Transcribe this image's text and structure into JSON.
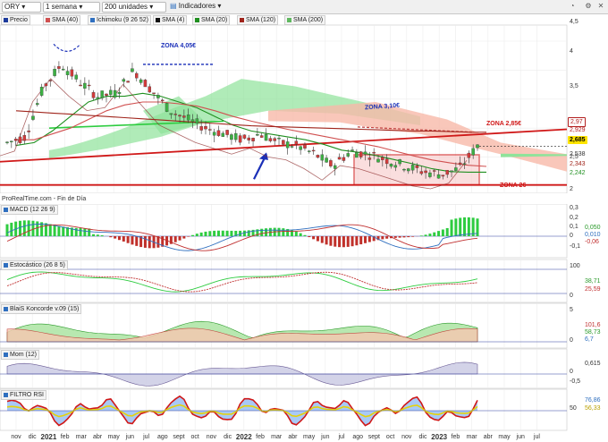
{
  "toolbar": {
    "symbol": "ORY",
    "timeframe": "1 semana",
    "units": "200 unidades",
    "indicators": "Indicadores"
  },
  "legend": [
    {
      "label": "Precio",
      "color": "#1c3a9c"
    },
    {
      "label": "SMA (40)",
      "color": "#d05050"
    },
    {
      "label": "Ichimoku (9 26 52)",
      "color": "#3070c0"
    },
    {
      "label": "SMA (4)",
      "color": "#111111"
    },
    {
      "label": "SMA (20)",
      "color": "#1f8f1f"
    },
    {
      "label": "SMA (120)",
      "color": "#a0241b"
    },
    {
      "label": "SMA (200)",
      "color": "#5fb85f"
    }
  ],
  "source_label": "ProRealTime.com - Fin de Día",
  "annotations": {
    "zona_405": "ZONA 4,05€",
    "zona_310": "ZONA 3,10€",
    "zona_285": "ZONA 2,85€",
    "zona_2": "ZONA 2€"
  },
  "price_axis": {
    "ticks": [
      "4,5",
      "4",
      "3,5",
      "3",
      "2,5",
      "2"
    ],
    "price_tags": [
      {
        "label": "2,97",
        "bg": "#ffffff",
        "fg": "#b32020"
      },
      {
        "label": "2,929",
        "bg": "#ffffff",
        "fg": "#b32020"
      },
      {
        "label": "2,685",
        "bg": "#ffe400",
        "fg": "#000000"
      },
      {
        "label": "2,538",
        "bg": "#ffffff",
        "fg": "#333333"
      },
      {
        "label": "2,343",
        "bg": "#ffffff",
        "fg": "#a0241b"
      },
      {
        "label": "2,242",
        "bg": "#ffffff",
        "fg": "#1f8f1f"
      }
    ]
  },
  "panels": {
    "macd": {
      "title": "MACD (12 26 9)",
      "ticks": [
        "0,3",
        "0,2",
        "0,1",
        "0",
        "-0,1"
      ],
      "tags": [
        {
          "label": "0,050",
          "fg": "#2a9a2a"
        },
        {
          "label": "0,010",
          "fg": "#2f6fbf"
        },
        {
          "label": "-0,06",
          "fg": "#c03030"
        }
      ]
    },
    "stoch": {
      "title": "Estocástico (26 8 5)",
      "ticks": [
        "100",
        "0"
      ],
      "tags": [
        {
          "label": "38,71",
          "fg": "#2a9a2a"
        },
        {
          "label": "25,59",
          "fg": "#c03030"
        }
      ]
    },
    "konc": {
      "title": "BlaiS Koncorde v.09 (15)",
      "ticks": [
        "5",
        "0"
      ],
      "tags": [
        {
          "label": "101,6",
          "fg": "#c03030"
        },
        {
          "label": "58,73",
          "fg": "#2a9a2a"
        },
        {
          "label": "6,7",
          "fg": "#2f6fbf"
        }
      ]
    },
    "mom": {
      "title": "Mom (12)",
      "ticks": [
        "0",
        "-0,5"
      ],
      "tags": [
        {
          "label": "0,615",
          "fg": "#333333"
        }
      ]
    },
    "rsi": {
      "title": "FILTRO RSI",
      "ticks": [
        "50"
      ],
      "tags": [
        {
          "label": "76,86",
          "fg": "#2f6fbf"
        },
        {
          "label": "56,33",
          "fg": "#b8a000"
        }
      ]
    }
  },
  "x_axis": [
    {
      "label": "nov",
      "bold": false
    },
    {
      "label": "dic",
      "bold": false
    },
    {
      "label": "2021",
      "bold": true
    },
    {
      "label": "feb",
      "bold": false
    },
    {
      "label": "mar",
      "bold": false
    },
    {
      "label": "abr",
      "bold": false
    },
    {
      "label": "may",
      "bold": false
    },
    {
      "label": "jun",
      "bold": false
    },
    {
      "label": "jul",
      "bold": false
    },
    {
      "label": "ago",
      "bold": false
    },
    {
      "label": "sept",
      "bold": false
    },
    {
      "label": "oct",
      "bold": false
    },
    {
      "label": "nov",
      "bold": false
    },
    {
      "label": "dic",
      "bold": false
    },
    {
      "label": "2022",
      "bold": true
    },
    {
      "label": "feb",
      "bold": false
    },
    {
      "label": "mar",
      "bold": false
    },
    {
      "label": "abr",
      "bold": false
    },
    {
      "label": "may",
      "bold": false
    },
    {
      "label": "jun",
      "bold": false
    },
    {
      "label": "jul",
      "bold": false
    },
    {
      "label": "ago",
      "bold": false
    },
    {
      "label": "sept",
      "bold": false
    },
    {
      "label": "oct",
      "bold": false
    },
    {
      "label": "nov",
      "bold": false
    },
    {
      "label": "dic",
      "bold": false
    },
    {
      "label": "2023",
      "bold": true
    },
    {
      "label": "feb",
      "bold": false
    },
    {
      "label": "mar",
      "bold": false
    },
    {
      "label": "abr",
      "bold": false
    },
    {
      "label": "may",
      "bold": false
    },
    {
      "label": "jun",
      "bold": false
    },
    {
      "label": "jul",
      "bold": false
    }
  ],
  "chart_data": {
    "type": "line",
    "x": [
      "nov",
      "dic",
      "2021",
      "feb",
      "mar",
      "abr",
      "may",
      "jun",
      "jul",
      "ago",
      "sept",
      "oct",
      "nov",
      "dic",
      "2022",
      "feb",
      "mar",
      "abr",
      "may",
      "jun",
      "jul",
      "ago",
      "sept",
      "oct",
      "nov",
      "dic",
      "2023"
    ],
    "series": [
      {
        "name": "Precio",
        "values": [
          2.75,
          2.85,
          3.7,
          4.1,
          3.8,
          3.55,
          3.6,
          4.0,
          3.65,
          3.3,
          3.15,
          3.0,
          2.9,
          2.8,
          2.9,
          2.75,
          2.7,
          2.55,
          2.35,
          2.6,
          2.55,
          2.45,
          2.35,
          2.25,
          2.2,
          2.3,
          2.69
        ]
      },
      {
        "name": "SMA (20)",
        "values": [
          2.7,
          2.75,
          2.95,
          3.2,
          3.45,
          3.55,
          3.55,
          3.6,
          3.55,
          3.45,
          3.35,
          3.2,
          3.05,
          2.95,
          2.9,
          2.85,
          2.8,
          2.72,
          2.62,
          2.58,
          2.52,
          2.45,
          2.38,
          2.3,
          2.25,
          2.24,
          2.24
        ]
      },
      {
        "name": "SMA (40)",
        "values": [
          2.8,
          2.8,
          2.9,
          3.0,
          3.15,
          3.3,
          3.4,
          3.45,
          3.45,
          3.42,
          3.38,
          3.3,
          3.2,
          3.12,
          3.05,
          2.98,
          2.92,
          2.86,
          2.8,
          2.74,
          2.68,
          2.6,
          2.52,
          2.45,
          2.4,
          2.36,
          2.34
        ]
      },
      {
        "name": "SMA (120)",
        "values": [
          3.3,
          3.28,
          3.26,
          3.24,
          3.22,
          3.2,
          3.18,
          3.16,
          3.14,
          3.12,
          3.1,
          3.08,
          3.06,
          3.04,
          3.03,
          3.02,
          3.01,
          3.0,
          2.99,
          2.98,
          2.97,
          2.96,
          2.95,
          2.95,
          2.94,
          2.93,
          2.929
        ]
      }
    ],
    "ylim": [
      2.0,
      4.5
    ],
    "annotations": [
      "ZONA 4,05€",
      "ZONA 3,10€",
      "ZONA 2,85€",
      "ZONA 2€"
    ]
  }
}
